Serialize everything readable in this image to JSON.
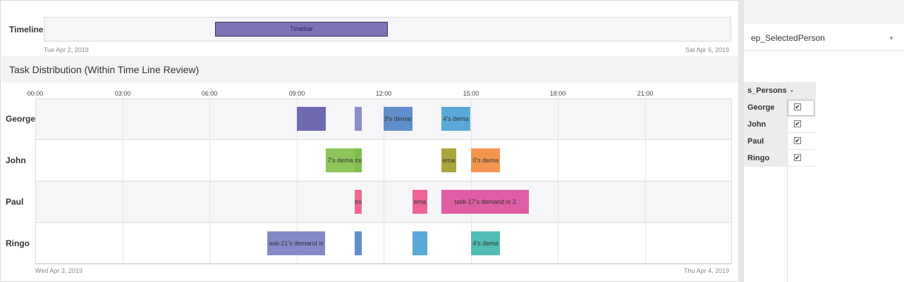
{
  "timeline": {
    "label": "Timeline",
    "timebar_label": "Timebar",
    "start_date": "Tue Apr 2, 2019",
    "end_date": "Sat Apr 6, 2019"
  },
  "section": {
    "title": "Task Distribution (Within Time Line Review)"
  },
  "gantt": {
    "hours": [
      "00:00",
      "03:00",
      "06:00",
      "09:00",
      "12:00",
      "15:00",
      "18:00",
      "21:00"
    ],
    "persons": [
      "George",
      "John",
      "Paul",
      "Ringo"
    ],
    "start_date": "Wed Apr 3, 2019",
    "end_date": "Thu Apr 4, 2019",
    "tasks": [
      {
        "person": 0,
        "start_hour": 9.0,
        "end_hour": 10.0,
        "label": "",
        "color": "#6f6ab0"
      },
      {
        "person": 0,
        "start_hour": 11.0,
        "end_hour": 11.25,
        "label": "",
        "color": "#8c8ec9"
      },
      {
        "person": 0,
        "start_hour": 12.0,
        "end_hour": 13.0,
        "label": "3's demar",
        "color": "#5f8fca"
      },
      {
        "person": 0,
        "start_hour": 14.0,
        "end_hour": 15.0,
        "label": "4's dema",
        "color": "#5aa8d8"
      },
      {
        "person": 1,
        "start_hour": 10.0,
        "end_hour": 11.0,
        "label": "7's dema",
        "color": "#8cc55a"
      },
      {
        "person": 1,
        "start_hour": 11.0,
        "end_hour": 11.25,
        "label": "ma",
        "color": "#7dbd4e"
      },
      {
        "person": 1,
        "start_hour": 14.0,
        "end_hour": 14.5,
        "label": "ema",
        "color": "#a8a63c"
      },
      {
        "person": 1,
        "start_hour": 15.0,
        "end_hour": 16.0,
        "label": "0's dema",
        "color": "#f4954f"
      },
      {
        "person": 2,
        "start_hour": 11.0,
        "end_hour": 11.25,
        "label": "ma",
        "color": "#ee6a8f"
      },
      {
        "person": 2,
        "start_hour": 13.0,
        "end_hour": 13.5,
        "label": "ema",
        "color": "#ee6396"
      },
      {
        "person": 2,
        "start_hour": 14.0,
        "end_hour": 17.0,
        "label": "task-17's demand is 3",
        "color": "#df5ea3"
      },
      {
        "person": 3,
        "start_hour": 8.0,
        "end_hour": 10.0,
        "label": "ask-21's demand is",
        "color": "#848ac8"
      },
      {
        "person": 3,
        "start_hour": 11.0,
        "end_hour": 11.25,
        "label": "",
        "color": "#5f8fca"
      },
      {
        "person": 3,
        "start_hour": 13.0,
        "end_hour": 13.5,
        "label": "",
        "color": "#5aa8d8"
      },
      {
        "person": 3,
        "start_hour": 15.0,
        "end_hour": 16.0,
        "label": "4's dema",
        "color": "#52bdb5"
      }
    ]
  },
  "panel": {
    "dropdown_value": "ep_SelectedPerson",
    "dropdown_caret": "▼",
    "table_header": "s_Persons",
    "table_header_col2": "-",
    "rows": [
      {
        "name": "George",
        "checked": true
      },
      {
        "name": "John",
        "checked": true
      },
      {
        "name": "Paul",
        "checked": true
      },
      {
        "name": "Ringo",
        "checked": true
      }
    ],
    "check_glyph": "✔"
  }
}
